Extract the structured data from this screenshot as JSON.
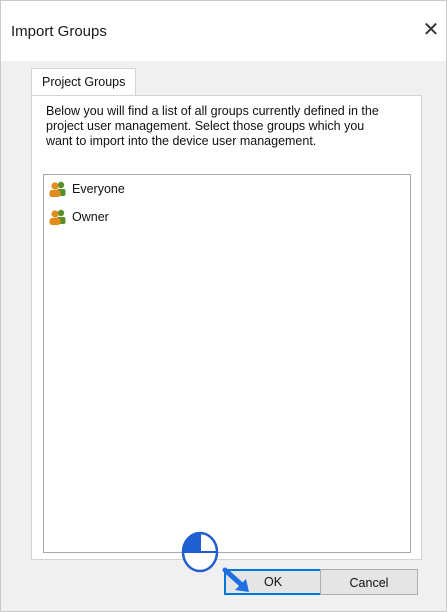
{
  "window": {
    "title": "Import Groups",
    "close_glyph": "✕"
  },
  "tab": {
    "label": "Project Groups"
  },
  "description": "Below you will find a list of all groups currently defined in the project user management. Select those groups which you want to import into the device user management.",
  "groups": [
    {
      "label": "Everyone",
      "icon": "group-icon"
    },
    {
      "label": "Owner",
      "icon": "group-icon"
    }
  ],
  "buttons": {
    "ok_label": "OK",
    "cancel_label": "Cancel"
  },
  "colors": {
    "accent": "#0078d7",
    "group_icon_front": "#e08b1a",
    "group_icon_back": "#5a8f2a"
  }
}
